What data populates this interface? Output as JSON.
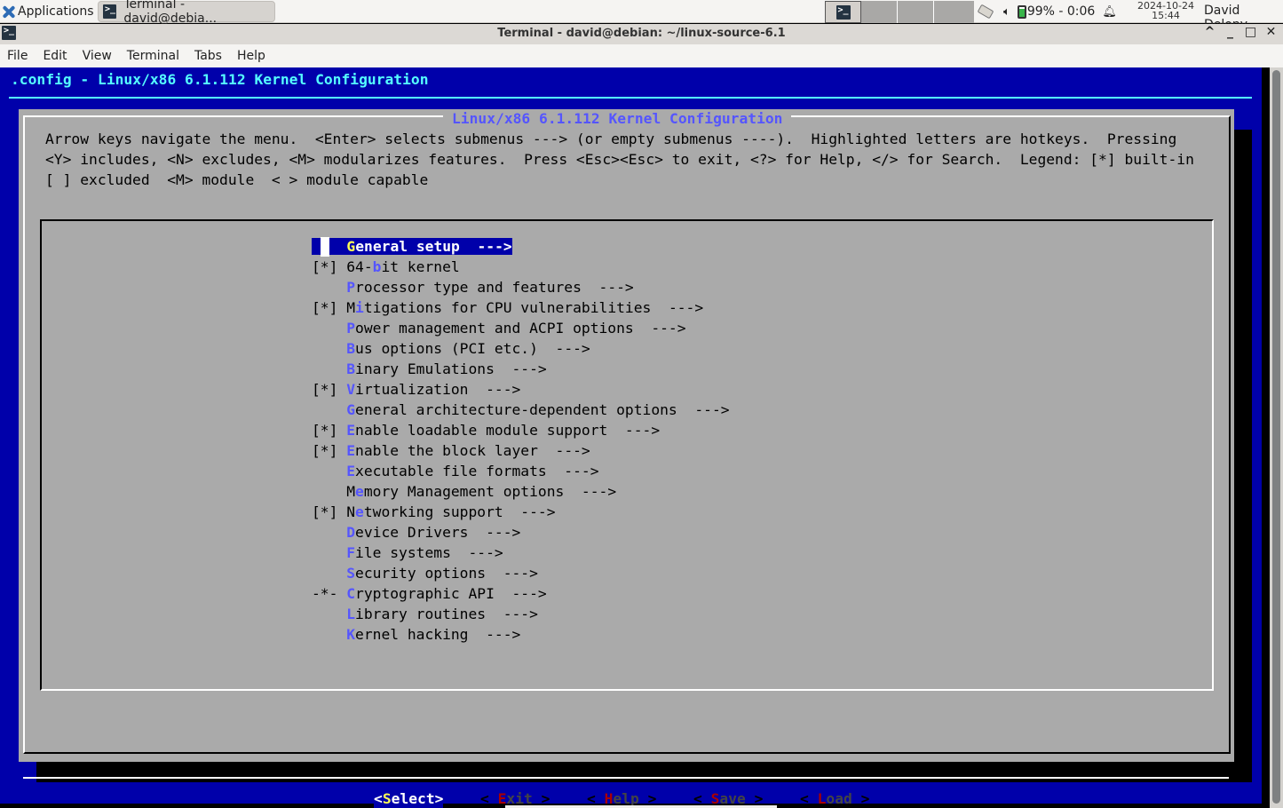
{
  "panel": {
    "applications_label": "Applications",
    "task_label": "Terminal - david@debia...",
    "battery_text": "99% - 0:06",
    "clock_date": "2024-10-24",
    "clock_time": "15:44",
    "user_name": "David Delony",
    "workspaces": 4,
    "active_workspace": 1
  },
  "window": {
    "title": "Terminal - david@debian: ~/linux-source-6.1",
    "buttons": [
      "^",
      "_",
      "□",
      "✕"
    ]
  },
  "menubar": [
    "File",
    "Edit",
    "View",
    "Terminal",
    "Tabs",
    "Help"
  ],
  "menuconfig": {
    "header": ".config - Linux/x86 6.1.112 Kernel Configuration",
    "dialog_title": "Linux/x86 6.1.112 Kernel Configuration",
    "help_lines": [
      "Arrow keys navigate the menu.  <Enter> selects submenus ---> (or empty submenus ----).  Highlighted letters are hotkeys.  Pressing",
      "<Y> includes, <N> excludes, <M> modularizes features.  Press <Esc><Esc> to exit, <?> for Help, </> for Search.  Legend: [*] built-in",
      "[ ] excluded  <M> module  < > module capable"
    ],
    "selected_index": 0,
    "items": [
      {
        "state": "   ",
        "pre": "",
        "hotkey": "G",
        "rest": "eneral setup",
        "suffix": "  --->"
      },
      {
        "state": "[*]",
        "pre": "64-",
        "hotkey": "b",
        "rest": "it kernel",
        "suffix": ""
      },
      {
        "state": "   ",
        "pre": "",
        "hotkey": "P",
        "rest": "rocessor type and features",
        "suffix": "  --->"
      },
      {
        "state": "[*]",
        "pre": "M",
        "hotkey": "i",
        "rest": "tigations for CPU vulnerabilities",
        "suffix": "  --->"
      },
      {
        "state": "   ",
        "pre": "",
        "hotkey": "P",
        "rest": "ower management and ACPI options",
        "suffix": "  --->"
      },
      {
        "state": "   ",
        "pre": "",
        "hotkey": "B",
        "rest": "us options (PCI etc.)",
        "suffix": "  --->"
      },
      {
        "state": "   ",
        "pre": "",
        "hotkey": "B",
        "rest": "inary Emulations",
        "suffix": "  --->"
      },
      {
        "state": "[*]",
        "pre": "",
        "hotkey": "V",
        "rest": "irtualization",
        "suffix": "  --->"
      },
      {
        "state": "   ",
        "pre": "",
        "hotkey": "G",
        "rest": "eneral architecture-dependent options",
        "suffix": "  --->"
      },
      {
        "state": "[*]",
        "pre": "",
        "hotkey": "E",
        "rest": "nable loadable module support",
        "suffix": "  --->"
      },
      {
        "state": "[*]",
        "pre": "",
        "hotkey": "E",
        "rest": "nable the block layer",
        "suffix": "  --->"
      },
      {
        "state": "   ",
        "pre": "",
        "hotkey": "E",
        "rest": "xecutable file formats",
        "suffix": "  --->"
      },
      {
        "state": "   ",
        "pre": "M",
        "hotkey": "e",
        "rest": "mory Management options",
        "suffix": "  --->"
      },
      {
        "state": "[*]",
        "pre": "N",
        "hotkey": "e",
        "rest": "tworking support",
        "suffix": "  --->"
      },
      {
        "state": "   ",
        "pre": "",
        "hotkey": "D",
        "rest": "evice Drivers",
        "suffix": "  --->"
      },
      {
        "state": "   ",
        "pre": "",
        "hotkey": "F",
        "rest": "ile systems",
        "suffix": "  --->"
      },
      {
        "state": "   ",
        "pre": "",
        "hotkey": "S",
        "rest": "ecurity options",
        "suffix": "  --->"
      },
      {
        "state": "-*-",
        "pre": "",
        "hotkey": "C",
        "rest": "ryptographic API",
        "suffix": "  --->"
      },
      {
        "state": "   ",
        "pre": "",
        "hotkey": "L",
        "rest": "ibrary routines",
        "suffix": "  --->"
      },
      {
        "state": "   ",
        "pre": "",
        "hotkey": "K",
        "rest": "ernel hacking",
        "suffix": "  --->"
      }
    ],
    "buttons": [
      {
        "open": "<",
        "hotkey": "S",
        "rest": "elect",
        "close": ">",
        "selected": true
      },
      {
        "open": "< ",
        "hotkey": "E",
        "rest": "xit",
        "close": " >",
        "selected": false
      },
      {
        "open": "< ",
        "hotkey": "H",
        "rest": "elp",
        "close": " >",
        "selected": false
      },
      {
        "open": "< ",
        "hotkey": "S",
        "rest": "ave",
        "close": " >",
        "selected": false
      },
      {
        "open": "< ",
        "hotkey": "L",
        "rest": "oad",
        "close": " >",
        "selected": false
      }
    ]
  },
  "colors": {
    "terminal_bg": "#0000aa",
    "dialog_bg": "#aaaaaa",
    "header_fg": "#55ffff",
    "hotkey_fg": "#5555ff",
    "selected_hotkey_fg": "#ffff55",
    "button_hotkey_fg": "#aa0000"
  }
}
